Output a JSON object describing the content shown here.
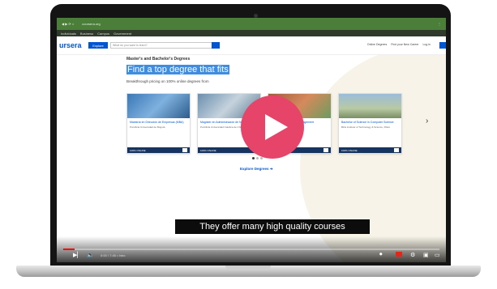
{
  "browser": {
    "address_url": "coursera.org",
    "bookmarks": [
      "Individuals",
      "Business",
      "Campus",
      "Government"
    ]
  },
  "site": {
    "logo": "ursera",
    "explore_label": "Explore",
    "search_placeholder": "What do you want to learn?",
    "header_links": [
      "Online Degrees",
      "Find your New Career",
      "Log in"
    ]
  },
  "hero": {
    "kicker": "Master's and Bachelor's Degrees",
    "headline_highlight": "Find a top degree that fits",
    "subheading": "Breakthrough pricing on 100% online degrees from"
  },
  "cards": [
    {
      "title": "Maestría en Dirección de Empresas (MBA)",
      "school": "Pontificia Universidad de Bogotá",
      "tag": "100% ONLINE"
    },
    {
      "title": "Magíster en Administración de Negocios",
      "school": "Pontificia Universidad Católica de Chile",
      "tag": "100% ONLINE"
    },
    {
      "title": "Master of Science in Management",
      "school": "",
      "tag": "100% ONLINE"
    },
    {
      "title": "Bachelor of Science in Computer Science",
      "school": "Birla Institute of Technology & Science, Pilani",
      "tag": "100% ONLINE"
    }
  ],
  "explore_degrees": "Explore Degrees ➔",
  "video": {
    "caption": "They offer many high quality courses",
    "time": "0:00 / 7:45 • Intro",
    "progress": 0.03
  },
  "colors": {
    "play_button": "#e74469",
    "brand_blue": "#0056d2",
    "highlight": "#3e8de3",
    "address_bar": "#4b7f39"
  }
}
